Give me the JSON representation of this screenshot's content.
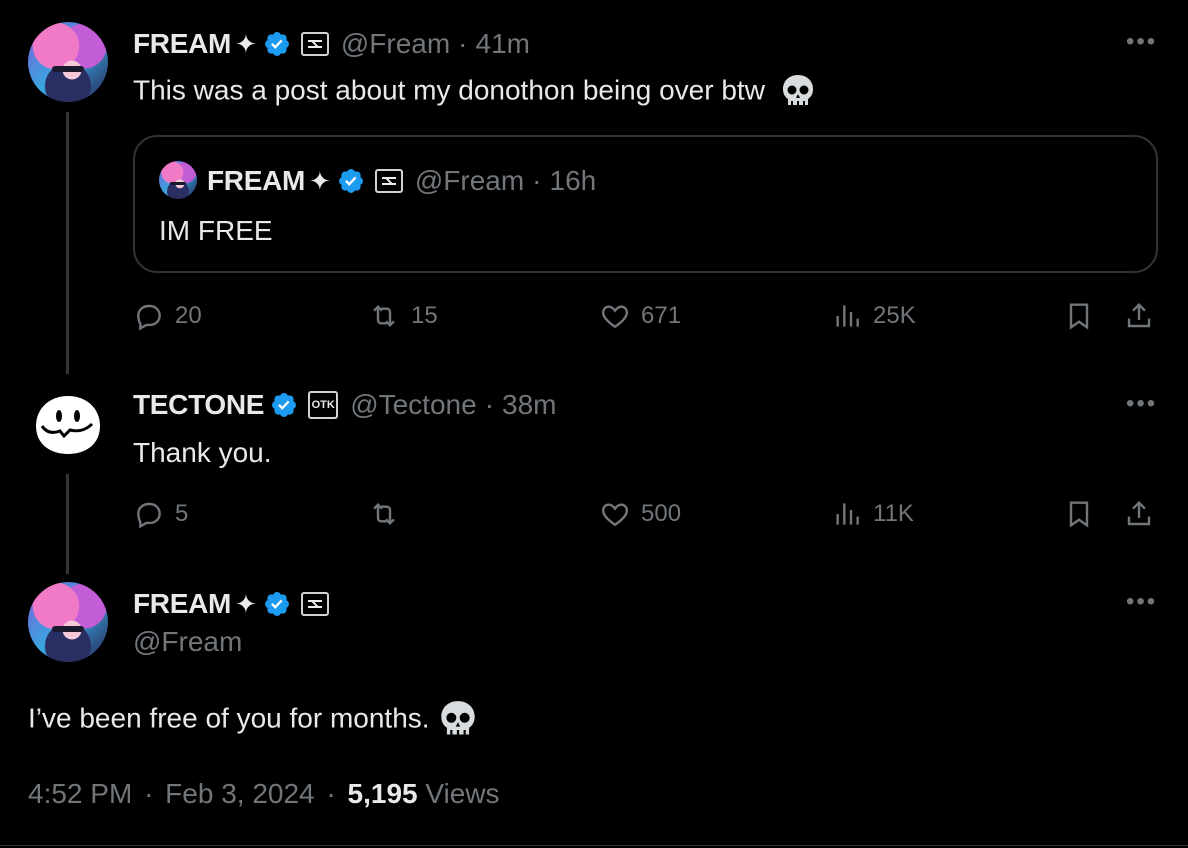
{
  "colors": {
    "accent": "#1d9bf0",
    "muted": "#71767b",
    "text": "#e7e9ea",
    "background": "#000000"
  },
  "post1": {
    "name": "FREAM",
    "name_suffix": "✦",
    "handle": "@Fream",
    "time": "41m",
    "text": "This was a post about my donothon being over btw",
    "emoji": "skull-icon",
    "quote": {
      "name": "FREAM",
      "name_suffix": "✦",
      "handle": "@Fream",
      "time": "16h",
      "text": "IM FREE"
    },
    "replies": "20",
    "reposts": "15",
    "likes": "671",
    "views": "25K"
  },
  "post2": {
    "name": "TECTONE",
    "handle": "@Tectone",
    "time": "38m",
    "text": "Thank you.",
    "badge_text": "OTK",
    "replies": "5",
    "reposts": "",
    "likes": "500",
    "views": "11K"
  },
  "main": {
    "name": "FREAM",
    "name_suffix": "✦",
    "handle": "@Fream",
    "text": "I’ve been free of you for months.",
    "time": "4:52 PM",
    "date": "Feb 3, 2024",
    "views_count": "5,195",
    "views_label": "Views"
  },
  "separator": "·"
}
